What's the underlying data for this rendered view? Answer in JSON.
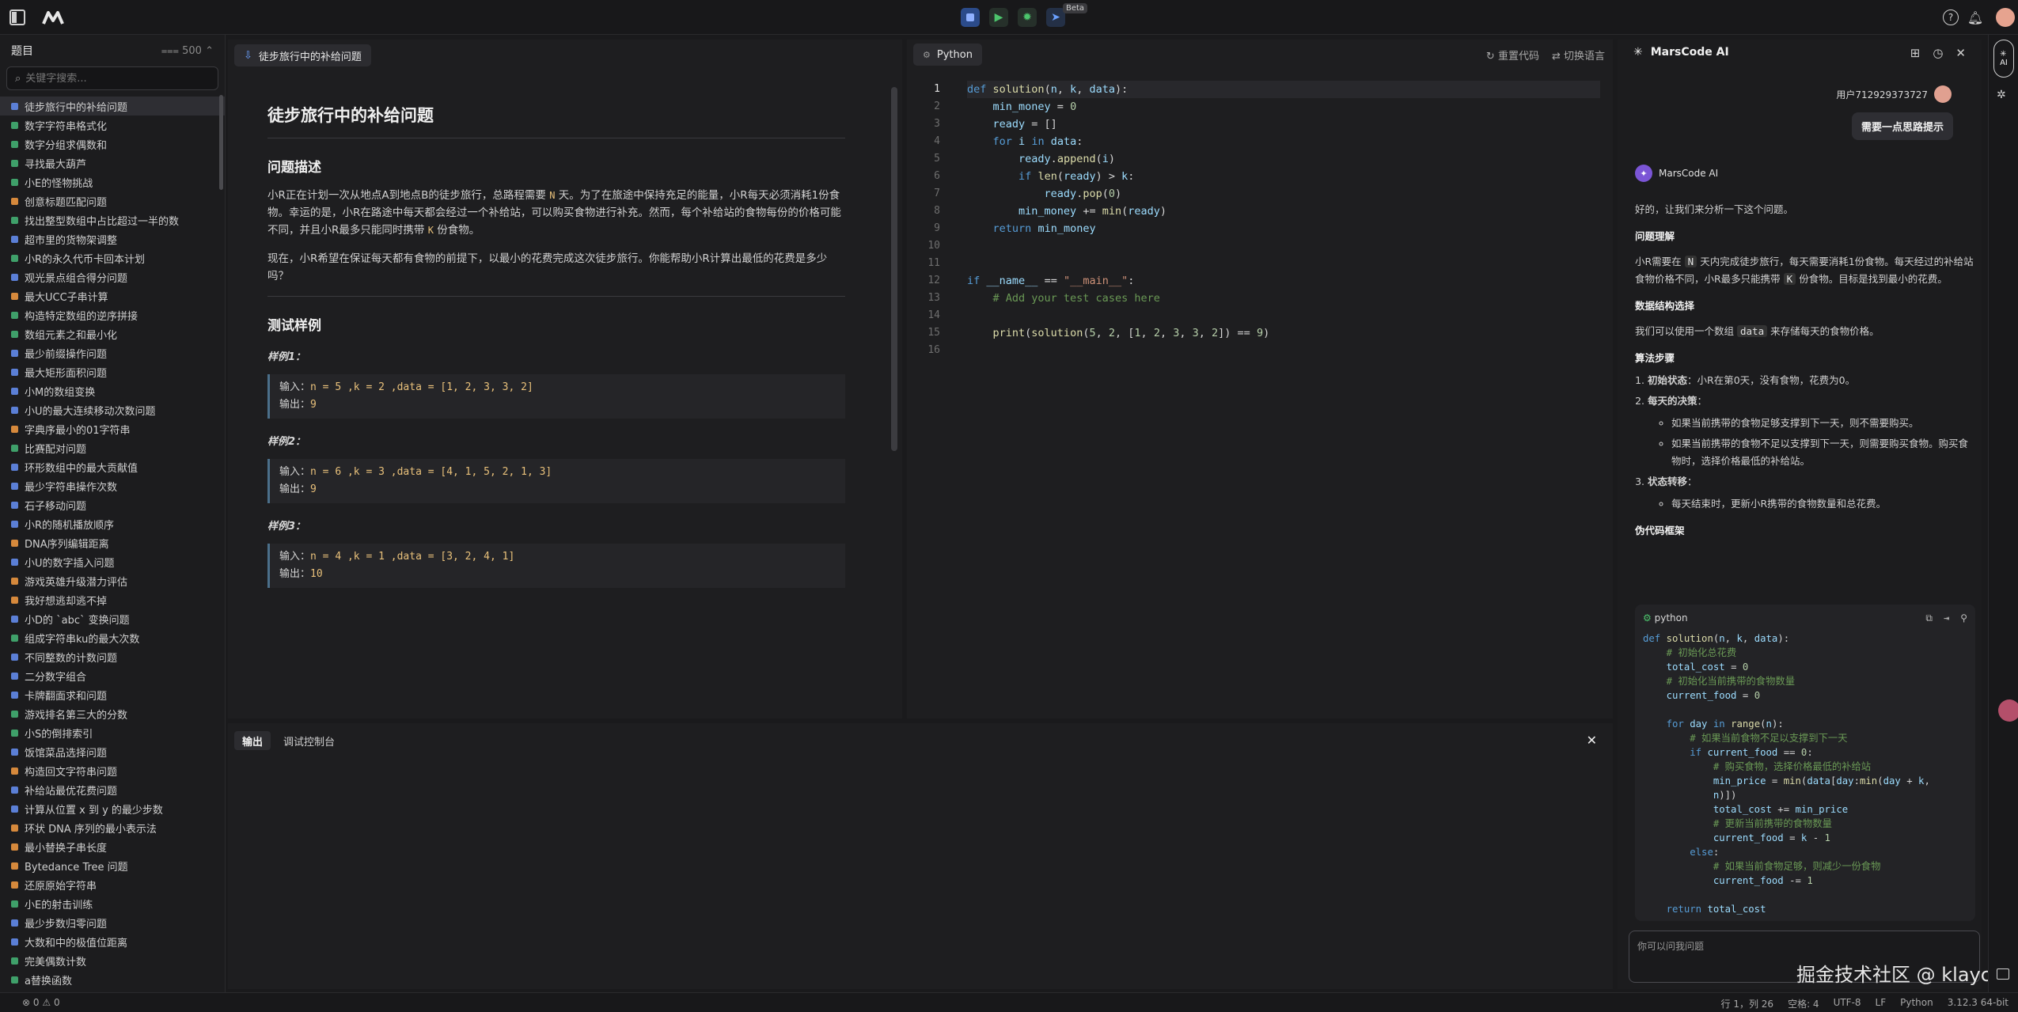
{
  "topbar": {
    "beta_label": "Beta"
  },
  "sidebar": {
    "title": "题目",
    "count": "500",
    "search_placeholder": "关键字搜索...",
    "items": [
      {
        "label": "徒步旅行中的补给问题",
        "color": "#5b7fd6"
      },
      {
        "label": "数字字符串格式化",
        "color": "#3fa06a"
      },
      {
        "label": "数字分组求偶数和",
        "color": "#3fa06a"
      },
      {
        "label": "寻找最大葫芦",
        "color": "#3fa06a"
      },
      {
        "label": "小E的怪物挑战",
        "color": "#3fa06a"
      },
      {
        "label": "创意标题匹配问题",
        "color": "#d6893c"
      },
      {
        "label": "找出整型数组中占比超过一半的数",
        "color": "#3fa06a"
      },
      {
        "label": "超市里的货物架调整",
        "color": "#5b7fd6"
      },
      {
        "label": "小R的永久代币卡回本计划",
        "color": "#3fa06a"
      },
      {
        "label": "观光景点组合得分问题",
        "color": "#5b7fd6"
      },
      {
        "label": "最大UCC子串计算",
        "color": "#d6893c"
      },
      {
        "label": "构造特定数组的逆序拼接",
        "color": "#3fa06a"
      },
      {
        "label": "数组元素之和最小化",
        "color": "#3fa06a"
      },
      {
        "label": "最少前缀操作问题",
        "color": "#5b7fd6"
      },
      {
        "label": "最大矩形面积问题",
        "color": "#5b7fd6"
      },
      {
        "label": "小M的数组变换",
        "color": "#5b7fd6"
      },
      {
        "label": "小U的最大连续移动次数问题",
        "color": "#5b7fd6"
      },
      {
        "label": "字典序最小的01字符串",
        "color": "#d6893c"
      },
      {
        "label": "比赛配对问题",
        "color": "#3fa06a"
      },
      {
        "label": "环形数组中的最大贡献值",
        "color": "#5b7fd6"
      },
      {
        "label": "最少字符串操作次数",
        "color": "#5b7fd6"
      },
      {
        "label": "石子移动问题",
        "color": "#5b7fd6"
      },
      {
        "label": "小R的随机播放顺序",
        "color": "#5b7fd6"
      },
      {
        "label": "DNA序列编辑距离",
        "color": "#d6893c"
      },
      {
        "label": "小U的数字插入问题",
        "color": "#5b7fd6"
      },
      {
        "label": "游戏英雄升级潜力评估",
        "color": "#d6893c"
      },
      {
        "label": "我好想逃却逃不掉",
        "color": "#d6893c"
      },
      {
        "label": "小D的 `abc` 变换问题",
        "color": "#5b7fd6"
      },
      {
        "label": "组成字符串ku的最大次数",
        "color": "#3fa06a"
      },
      {
        "label": "不同整数的计数问题",
        "color": "#5b7fd6"
      },
      {
        "label": "二分数字组合",
        "color": "#5b7fd6"
      },
      {
        "label": "卡牌翻面求和问题",
        "color": "#5b7fd6"
      },
      {
        "label": "游戏排名第三大的分数",
        "color": "#3fa06a"
      },
      {
        "label": "小S的倒排索引",
        "color": "#3fa06a"
      },
      {
        "label": "饭馆菜品选择问题",
        "color": "#5b7fd6"
      },
      {
        "label": "构造回文字符串问题",
        "color": "#d6893c"
      },
      {
        "label": "补给站最优花费问题",
        "color": "#5b7fd6"
      },
      {
        "label": "计算从位置 x 到 y 的最少步数",
        "color": "#5b7fd6"
      },
      {
        "label": "环状 DNA 序列的最小表示法",
        "color": "#d6893c"
      },
      {
        "label": "最小替换子串长度",
        "color": "#d6893c"
      },
      {
        "label": "Bytedance Tree 问题",
        "color": "#d6893c"
      },
      {
        "label": "还原原始字符串",
        "color": "#d6893c"
      },
      {
        "label": "小E的射击训练",
        "color": "#3fa06a"
      },
      {
        "label": "最少步数归零问题",
        "color": "#5b7fd6"
      },
      {
        "label": "大数和中的极值位距离",
        "color": "#5b7fd6"
      },
      {
        "label": "完美偶数计数",
        "color": "#3fa06a"
      },
      {
        "label": "a替换函数",
        "color": "#3fa06a"
      }
    ]
  },
  "problem": {
    "tab": "徒步旅行中的补给问题",
    "title": "徒步旅行中的补给问题",
    "desc_heading": "问题描述",
    "desc_p1_a": "小R正在计划一次从地点A到地点B的徒步旅行，总路程需要",
    "desc_p1_n": "N",
    "desc_p1_b": "天。为了在旅途中保持充足的能量，小R每天必须消耗1份食物。幸运的是，小R在路途中每天都会经过一个补给站，可以购买食物进行补充。然而，每个补给站的食物每份的价格可能不同，并且小R最多只能同时携带",
    "desc_p1_k": "K",
    "desc_p1_c": "份食物。",
    "desc_p2": "现在，小R希望在保证每天都有食物的前提下，以最小的花费完成这次徒步旅行。你能帮助小R计算出最低的花费是多少吗？",
    "tests_heading": "测试样例",
    "examples": [
      {
        "label": "样例1：",
        "input_prefix": "输入：",
        "input": "n = 5 ,k = 2 ,data = [1, 2, 3, 3, 2]",
        "output_prefix": "输出：",
        "output": "9"
      },
      {
        "label": "样例2：",
        "input_prefix": "输入：",
        "input": "n = 6 ,k = 3 ,data = [4, 1, 5, 2, 1, 3]",
        "output_prefix": "输出：",
        "output": "9"
      },
      {
        "label": "样例3：",
        "input_prefix": "输入：",
        "input": "n = 4 ,k = 1 ,data = [3, 2, 4, 1]",
        "output_prefix": "输出：",
        "output": "10"
      }
    ]
  },
  "editor": {
    "tab": "Python",
    "reset_label": "重置代码",
    "switch_label": "切换语言",
    "line_numbers": [
      "1",
      "2",
      "3",
      "4",
      "5",
      "6",
      "7",
      "8",
      "9",
      "10",
      "11",
      "12",
      "13",
      "14",
      "15",
      "16"
    ]
  },
  "output_panel": {
    "tab_output": "输出",
    "tab_console": "调试控制台"
  },
  "ai": {
    "title": "MarsCode AI",
    "user_name": "用户712929373727",
    "user_message": "需要一点思路提示",
    "bot_name": "MarsCode AI",
    "intro": "好的，让我们来分析一下这个问题。",
    "sec1": "问题理解",
    "sec1_a": "小R需要在",
    "sec1_n": "N",
    "sec1_b": "天内完成徒步旅行，每天需要消耗1份食物。每天经过的补给站食物价格不同，小R最多只能携带",
    "sec1_k": "K",
    "sec1_c": "份食物。目标是找到最小的花费。",
    "sec2": "数据结构选择",
    "sec2_a": "我们可以使用一个数组",
    "sec2_chip": "data",
    "sec2_b": "来存储每天的食物价格。",
    "sec3": "算法步骤",
    "step1_b": "初始状态",
    "step1": "：小R在第0天，没有食物，花费为0。",
    "step2_b": "每天的决策",
    "step2": "：",
    "bullet1": "如果当前携带的食物足够支撑到下一天，则不需要购买。",
    "bullet2": "如果当前携带的食物不足以支撑到下一天，则需要购买食物。购买食物时，选择价格最低的补给站。",
    "step3_b": "状态转移",
    "step3": "：",
    "bullet3": "每天结束时，更新小R携带的食物数量和总花费。",
    "sec4": "伪代码框架",
    "code_lang": "python",
    "input_placeholder": "你可以问我问题"
  },
  "watermark": "掘金技术社区 @ klayc",
  "status": {
    "errors": "0",
    "warnings": "0",
    "position": "行 1，列 26",
    "spaces": "空格: 4",
    "encoding": "UTF-8",
    "eol": "LF",
    "language": "Python",
    "version": "3.12.3 64-bit"
  }
}
